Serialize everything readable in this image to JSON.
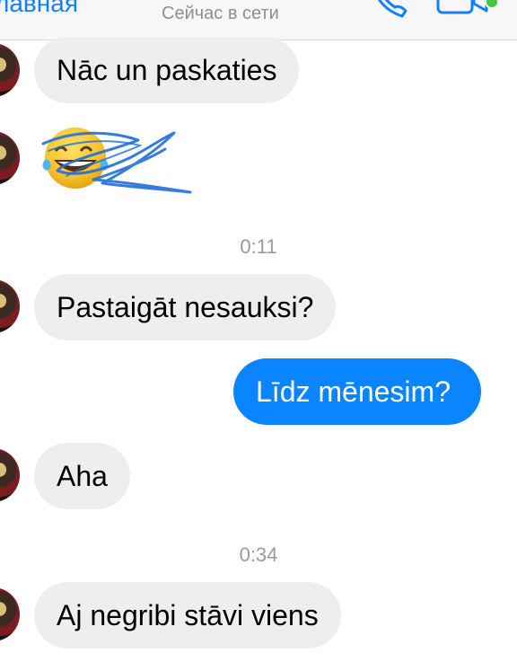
{
  "header": {
    "back_label": "лавная",
    "status": "Сейчас в сети",
    "online_color": "#44c63e"
  },
  "messages": [
    {
      "direction": "incoming",
      "text": "Nāc un paskaties"
    },
    {
      "direction": "incoming",
      "type": "emoji",
      "emoji": "face-with-tears-of-joy (scribbled over)"
    },
    {
      "type": "timestamp",
      "text": "0:11"
    },
    {
      "direction": "incoming",
      "text": "Pastaigāt nesauksi?"
    },
    {
      "direction": "outgoing",
      "text": "Līdz mēnesim?"
    },
    {
      "direction": "incoming",
      "text": "Aha"
    },
    {
      "type": "timestamp",
      "text": "0:34"
    },
    {
      "direction": "incoming",
      "text": "Aj negribi  stāvi viens"
    }
  ],
  "colors": {
    "accent": "#147efb",
    "outgoing_bubble": "#0a84ff",
    "incoming_bubble": "#eeeef0",
    "timestamp": "#9a9aa0"
  }
}
